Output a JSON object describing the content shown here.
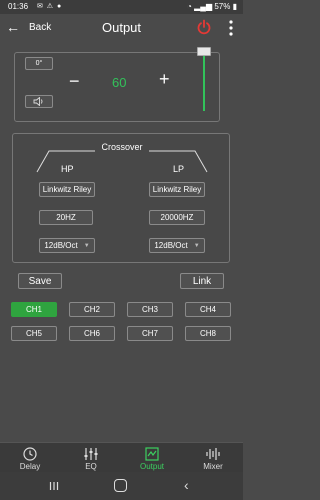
{
  "status_bar": {
    "time": "01:36",
    "battery": "57%"
  },
  "app_bar": {
    "back_label": "Back",
    "title": "Output"
  },
  "volume": {
    "phase_label": "0°",
    "minus": "−",
    "value": "60",
    "plus": "+",
    "slider_level": 1.0
  },
  "crossover": {
    "title": "Crossover",
    "hp": {
      "label": "HP",
      "filter_type": "Linkwitz Riley",
      "frequency": "20HZ",
      "slope": "12dB/Oct"
    },
    "lp": {
      "label": "LP",
      "filter_type": "Linkwitz Riley",
      "frequency": "20000HZ",
      "slope": "12dB/Oct"
    }
  },
  "actions": {
    "save": "Save",
    "link": "Link"
  },
  "channels": [
    "CH1",
    "CH2",
    "CH3",
    "CH4",
    "CH5",
    "CH6",
    "CH7",
    "CH8"
  ],
  "active_channel": "CH1",
  "bottom_nav": [
    "Delay",
    "EQ",
    "Output",
    "Mixer"
  ],
  "colors": {
    "accent_green": "#32c25a",
    "power_red": "#e53935",
    "background": "#4a4a4a"
  }
}
